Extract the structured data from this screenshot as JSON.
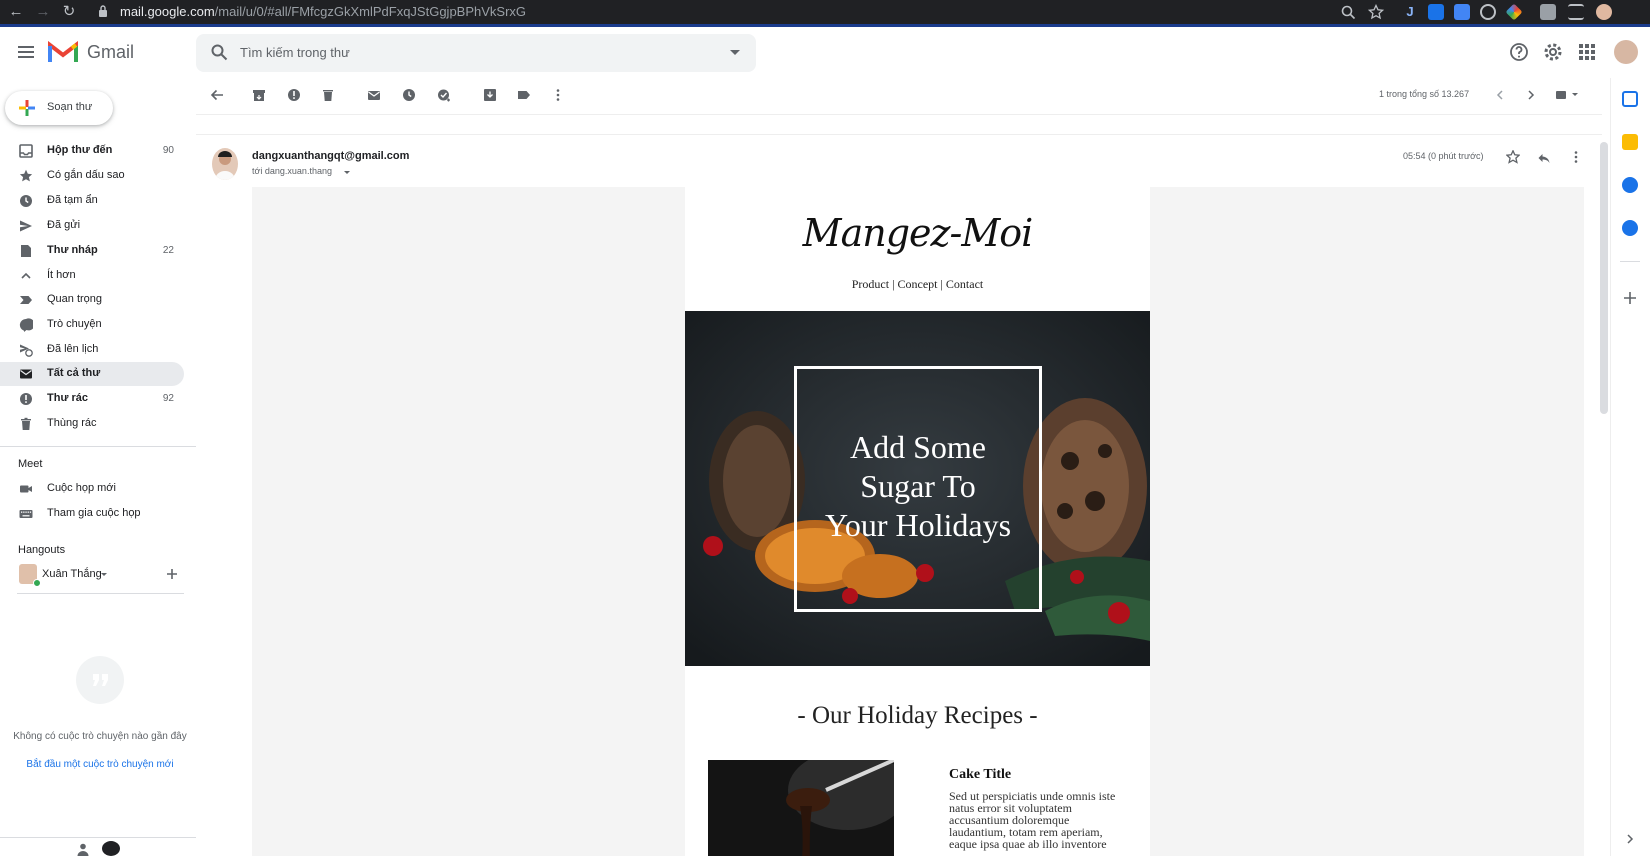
{
  "browser": {
    "url_host": "mail.google.com",
    "url_path": "/mail/u/0/#all/FMfcgzGkXmlPdFxqJStGgjpBPhVkSrxG"
  },
  "app": {
    "name": "Gmail"
  },
  "search": {
    "placeholder": "Tìm kiếm trong thư"
  },
  "compose": {
    "label": "Soạn thư"
  },
  "sidebar": {
    "items": [
      {
        "label": "Hộp thư đến",
        "count": "90",
        "bold": true
      },
      {
        "label": "Có gắn dấu sao",
        "count": ""
      },
      {
        "label": "Đã tạm ẩn",
        "count": ""
      },
      {
        "label": "Đã gửi",
        "count": ""
      },
      {
        "label": "Thư nháp",
        "count": "22",
        "bold": true
      },
      {
        "label": "Ít hơn",
        "count": ""
      },
      {
        "label": "Quan trọng",
        "count": ""
      },
      {
        "label": "Trò chuyện",
        "count": ""
      },
      {
        "label": "Đã lên lịch",
        "count": ""
      },
      {
        "label": "Tất cả thư",
        "count": "",
        "active": true
      },
      {
        "label": "Thư rác",
        "count": "92",
        "bold": true
      },
      {
        "label": "Thùng rác",
        "count": ""
      }
    ],
    "meet": {
      "title": "Meet",
      "new_meeting": "Cuộc họp mới",
      "join_meeting": "Tham gia cuộc họp"
    },
    "hangouts": {
      "title": "Hangouts",
      "user": "Xuân Thắng",
      "empty_text": "Không có cuộc trò chuyện nào gần đây",
      "start_link": "Bắt đầu một cuộc trò chuyện mới"
    }
  },
  "toolbar": {
    "pager": "1 trong tổng số 13.267"
  },
  "message": {
    "sender": "dangxuanthangqt@gmail.com",
    "to": "tới dang.xuan.thang",
    "time": "05:54 (0 phút trước)"
  },
  "email": {
    "brand": "Mangez-Moi",
    "nav": [
      "Product",
      "Concept",
      "Contact"
    ],
    "nav_sep": " | ",
    "hero_text": [
      "Add Some",
      "Sugar To",
      "Your Holidays"
    ],
    "section_title": "- Our Holiday Recipes -",
    "recipe_title": "Cake Title",
    "recipe_body": "Sed ut perspiciatis unde omnis iste natus error sit voluptatem accusantium doloremque laudantium, totam rem aperiam, eaque ipsa quae ab illo inventore"
  },
  "colors": {
    "chrome_bg": "#202124",
    "accent_blue": "#1a73e8",
    "active_nav": "#e8eaed",
    "email_bg": "#f4f4f4",
    "hero_bg": "#1d2226"
  }
}
